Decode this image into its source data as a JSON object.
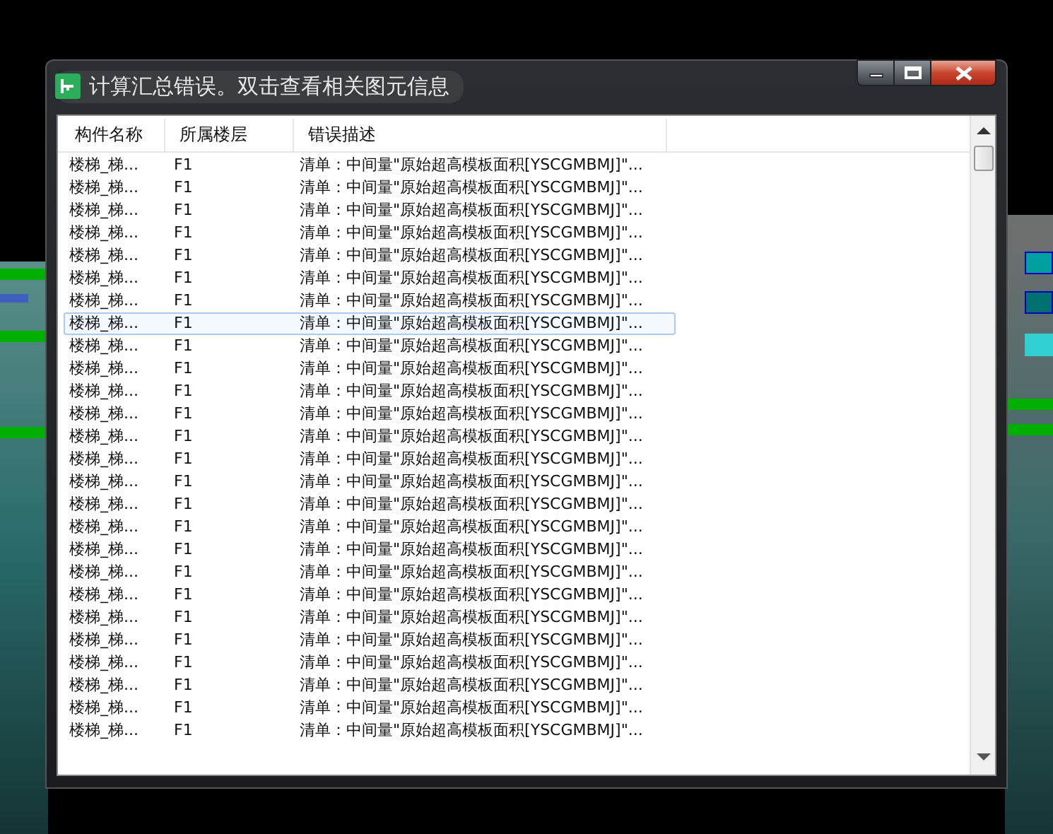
{
  "window": {
    "title": "计算汇总错误。双击查看相关图元信息",
    "buttons": [
      {
        "kind": "minimize"
      },
      {
        "kind": "maximize"
      },
      {
        "kind": "close"
      }
    ]
  },
  "table": {
    "columns": [
      "构件名称",
      "所属楼层",
      "错误描述"
    ],
    "rows": [
      {
        "cells": [
          "楼梯_梯...",
          "F1",
          "清单：中间量\"原始超高模板面积[YSCGMBMJ]\"..."
        ],
        "selected": false
      },
      {
        "cells": [
          "楼梯_梯...",
          "F1",
          "清单：中间量\"原始超高模板面积[YSCGMBMJ]\"..."
        ],
        "selected": false
      },
      {
        "cells": [
          "楼梯_梯...",
          "F1",
          "清单：中间量\"原始超高模板面积[YSCGMBMJ]\"..."
        ],
        "selected": false
      },
      {
        "cells": [
          "楼梯_梯...",
          "F1",
          "清单：中间量\"原始超高模板面积[YSCGMBMJ]\"..."
        ],
        "selected": false
      },
      {
        "cells": [
          "楼梯_梯...",
          "F1",
          "清单：中间量\"原始超高模板面积[YSCGMBMJ]\"..."
        ],
        "selected": false
      },
      {
        "cells": [
          "楼梯_梯...",
          "F1",
          "清单：中间量\"原始超高模板面积[YSCGMBMJ]\"..."
        ],
        "selected": false
      },
      {
        "cells": [
          "楼梯_梯...",
          "F1",
          "清单：中间量\"原始超高模板面积[YSCGMBMJ]\"..."
        ],
        "selected": false
      },
      {
        "cells": [
          "楼梯_梯...",
          "F1",
          "清单：中间量\"原始超高模板面积[YSCGMBMJ]\"..."
        ],
        "selected": true
      },
      {
        "cells": [
          "楼梯_梯...",
          "F1",
          "清单：中间量\"原始超高模板面积[YSCGMBMJ]\"..."
        ],
        "selected": false
      },
      {
        "cells": [
          "楼梯_梯...",
          "F1",
          "清单：中间量\"原始超高模板面积[YSCGMBMJ]\"..."
        ],
        "selected": false
      },
      {
        "cells": [
          "楼梯_梯...",
          "F1",
          "清单：中间量\"原始超高模板面积[YSCGMBMJ]\"..."
        ],
        "selected": false
      },
      {
        "cells": [
          "楼梯_梯...",
          "F1",
          "清单：中间量\"原始超高模板面积[YSCGMBMJ]\"..."
        ],
        "selected": false
      },
      {
        "cells": [
          "楼梯_梯...",
          "F1",
          "清单：中间量\"原始超高模板面积[YSCGMBMJ]\"..."
        ],
        "selected": false
      },
      {
        "cells": [
          "楼梯_梯...",
          "F1",
          "清单：中间量\"原始超高模板面积[YSCGMBMJ]\"..."
        ],
        "selected": false
      },
      {
        "cells": [
          "楼梯_梯...",
          "F1",
          "清单：中间量\"原始超高模板面积[YSCGMBMJ]\"..."
        ],
        "selected": false
      },
      {
        "cells": [
          "楼梯_梯...",
          "F1",
          "清单：中间量\"原始超高模板面积[YSCGMBMJ]\"..."
        ],
        "selected": false
      },
      {
        "cells": [
          "楼梯_梯...",
          "F1",
          "清单：中间量\"原始超高模板面积[YSCGMBMJ]\"..."
        ],
        "selected": false
      },
      {
        "cells": [
          "楼梯_梯...",
          "F1",
          "清单：中间量\"原始超高模板面积[YSCGMBMJ]\"..."
        ],
        "selected": false
      },
      {
        "cells": [
          "楼梯_梯...",
          "F1",
          "清单：中间量\"原始超高模板面积[YSCGMBMJ]\"..."
        ],
        "selected": false
      },
      {
        "cells": [
          "楼梯_梯...",
          "F1",
          "清单：中间量\"原始超高模板面积[YSCGMBMJ]\"..."
        ],
        "selected": false
      },
      {
        "cells": [
          "楼梯_梯...",
          "F1",
          "清单：中间量\"原始超高模板面积[YSCGMBMJ]\"..."
        ],
        "selected": false
      },
      {
        "cells": [
          "楼梯_梯...",
          "F1",
          "清单：中间量\"原始超高模板面积[YSCGMBMJ]\"..."
        ],
        "selected": false
      },
      {
        "cells": [
          "楼梯_梯...",
          "F1",
          "清单：中间量\"原始超高模板面积[YSCGMBMJ]\"..."
        ],
        "selected": false
      },
      {
        "cells": [
          "楼梯_梯...",
          "F1",
          "清单：中间量\"原始超高模板面积[YSCGMBMJ]\"..."
        ],
        "selected": false
      },
      {
        "cells": [
          "楼梯_梯...",
          "F1",
          "清单：中间量\"原始超高模板面积[YSCGMBMJ]\"..."
        ],
        "selected": false
      },
      {
        "cells": [
          "楼梯_梯...",
          "F1",
          "清单：中间量\"原始超高模板面积[YSCGMBMJ]\"..."
        ],
        "selected": false
      }
    ]
  }
}
